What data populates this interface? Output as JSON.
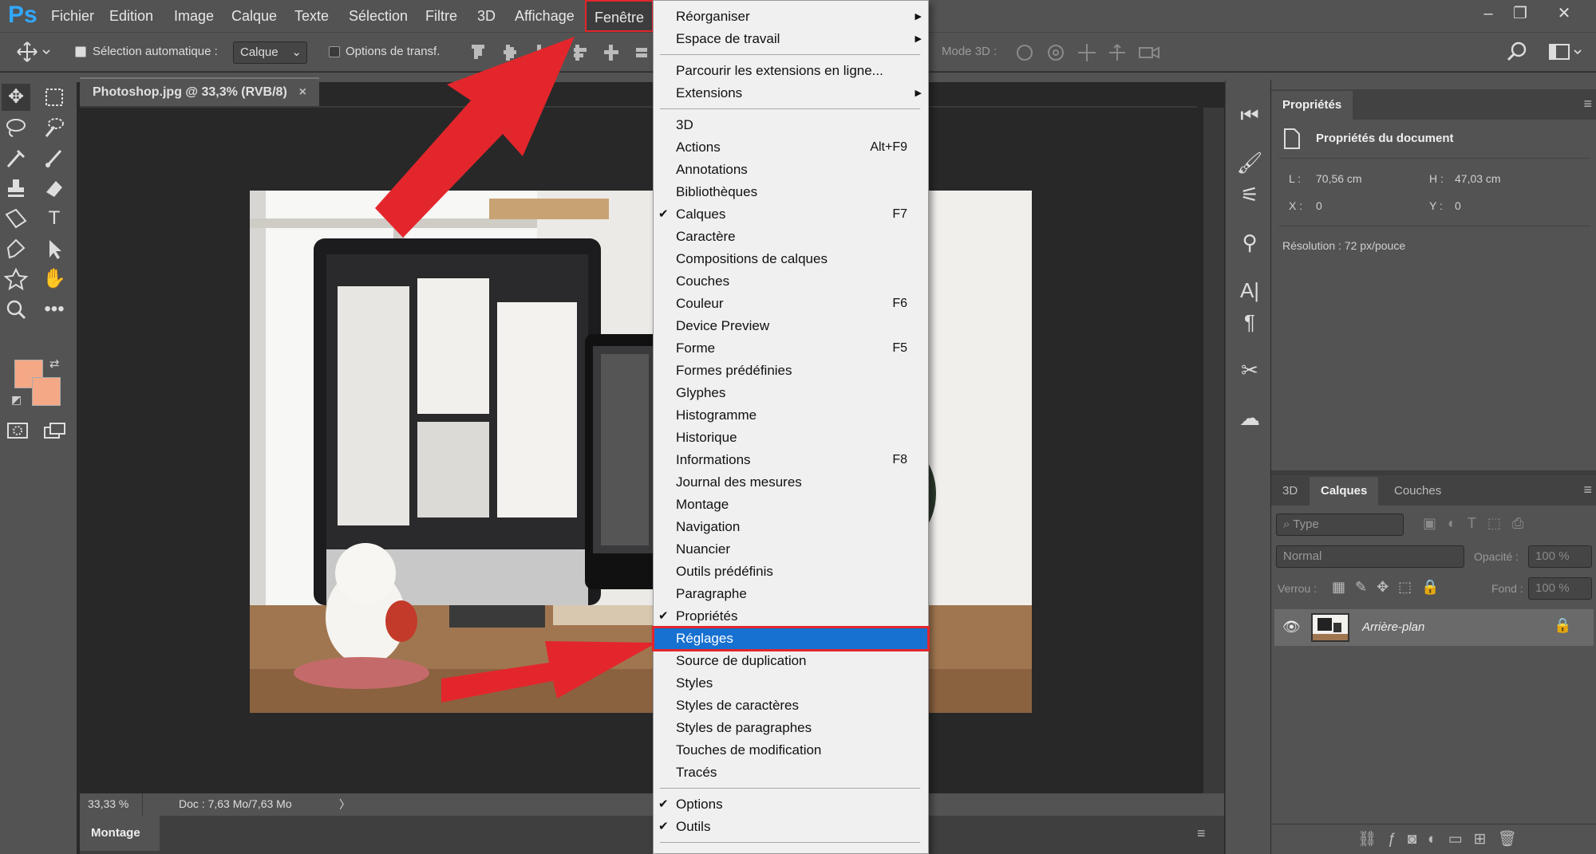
{
  "app": {
    "logo": "Ps"
  },
  "menubar": {
    "items": [
      "Fichier",
      "Edition",
      "Image",
      "Calque",
      "Texte",
      "Sélection",
      "Filtre",
      "3D",
      "Affichage",
      "Fenêtre"
    ],
    "window_controls": {
      "minimize": "–",
      "restore": "❐",
      "close": "✕"
    }
  },
  "options": {
    "auto_select_label": "Sélection automatique :",
    "auto_select_checked": true,
    "target_value": "Calque",
    "transform_label": "Options de transf.",
    "mode3d_label": "Mode 3D :"
  },
  "document": {
    "tab_title": "Photoshop.jpg @ 33,3% (RVB/8)",
    "close_glyph": "×",
    "zoom": "33,33 %",
    "doc_info": "Doc : 7,63 Mo/7,63 Mo",
    "status_arrow": "〉",
    "bottom_panel_label": "Montage"
  },
  "colors": {
    "foreground": "#f5a886",
    "background": "#f5a886",
    "accent": "#1671d1",
    "arrow": "#e3262c"
  },
  "properties": {
    "tab": "Propriétés",
    "section_title": "Propriétés du document",
    "width_label": "L :",
    "width_value": "70,56 cm",
    "height_label": "H :",
    "height_value": "47,03 cm",
    "x_label": "X :",
    "x_value": "0",
    "y_label": "Y :",
    "y_value": "0",
    "resolution": "Résolution : 72 px/pouce"
  },
  "layers": {
    "tabs": [
      "3D",
      "Calques",
      "Couches"
    ],
    "active_tab": "Calques",
    "filter_placeholder": "Type",
    "blend_mode": "Normal",
    "opacity_label": "Opacité :",
    "opacity_value": "100 %",
    "lock_label": "Verrou :",
    "fill_label": "Fond :",
    "fill_value": "100 %",
    "layer_name": "Arrière-plan"
  },
  "window_menu": {
    "items": [
      {
        "label": "Réorganiser",
        "submenu": true
      },
      {
        "label": "Espace de travail",
        "submenu": true
      },
      {
        "sep": true
      },
      {
        "label": "Parcourir les extensions en ligne..."
      },
      {
        "label": "Extensions",
        "submenu": true
      },
      {
        "sep": true
      },
      {
        "label": "3D"
      },
      {
        "label": "Actions",
        "shortcut": "Alt+F9"
      },
      {
        "label": "Annotations"
      },
      {
        "label": "Bibliothèques"
      },
      {
        "label": "Calques",
        "shortcut": "F7",
        "checked": true
      },
      {
        "label": "Caractère"
      },
      {
        "label": "Compositions de calques"
      },
      {
        "label": "Couches"
      },
      {
        "label": "Couleur",
        "shortcut": "F6"
      },
      {
        "label": "Device Preview"
      },
      {
        "label": "Forme",
        "shortcut": "F5"
      },
      {
        "label": "Formes prédéfinies"
      },
      {
        "label": "Glyphes"
      },
      {
        "label": "Histogramme"
      },
      {
        "label": "Historique"
      },
      {
        "label": "Informations",
        "shortcut": "F8"
      },
      {
        "label": "Journal des mesures"
      },
      {
        "label": "Montage"
      },
      {
        "label": "Navigation"
      },
      {
        "label": "Nuancier"
      },
      {
        "label": "Outils prédéfinis"
      },
      {
        "label": "Paragraphe"
      },
      {
        "label": "Propriétés",
        "checked": true
      },
      {
        "label": "Réglages",
        "highlighted": true
      },
      {
        "label": "Source de duplication"
      },
      {
        "label": "Styles"
      },
      {
        "label": "Styles de caractères"
      },
      {
        "label": "Styles de paragraphes"
      },
      {
        "label": "Touches de modification"
      },
      {
        "label": "Tracés"
      },
      {
        "sep": true
      },
      {
        "label": "Options",
        "checked": true
      },
      {
        "label": "Outils",
        "checked": true
      },
      {
        "sep": true
      }
    ],
    "check_glyph": "✔",
    "submenu_glyph": "▶"
  }
}
